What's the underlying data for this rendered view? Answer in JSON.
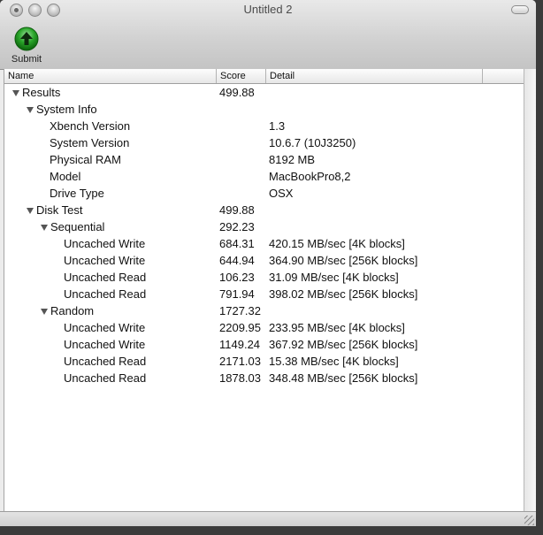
{
  "window": {
    "title": "Untitled 2"
  },
  "toolbar": {
    "submit_label": "Submit",
    "submit_icon": "up-arrow-circle-icon",
    "submit_color": "#1a9a1a"
  },
  "columns": [
    "Name",
    "Score",
    "Detail",
    ""
  ],
  "rows": [
    {
      "name": "Results",
      "score": "499.88",
      "detail": ""
    },
    {
      "name": "System Info",
      "score": "",
      "detail": ""
    },
    {
      "name": "Xbench Version",
      "score": "",
      "detail": "1.3"
    },
    {
      "name": "System Version",
      "score": "",
      "detail": "10.6.7 (10J3250)"
    },
    {
      "name": "Physical RAM",
      "score": "",
      "detail": "8192 MB"
    },
    {
      "name": "Model",
      "score": "",
      "detail": "MacBookPro8,2"
    },
    {
      "name": "Drive Type",
      "score": "",
      "detail": "OSX"
    },
    {
      "name": "Disk Test",
      "score": "499.88",
      "detail": ""
    },
    {
      "name": "Sequential",
      "score": "292.23",
      "detail": ""
    },
    {
      "name": "Uncached Write",
      "score": "684.31",
      "detail": "420.15 MB/sec [4K blocks]"
    },
    {
      "name": "Uncached Write",
      "score": "644.94",
      "detail": "364.90 MB/sec [256K blocks]"
    },
    {
      "name": "Uncached Read",
      "score": "106.23",
      "detail": "31.09 MB/sec [4K blocks]"
    },
    {
      "name": "Uncached Read",
      "score": "791.94",
      "detail": "398.02 MB/sec [256K blocks]"
    },
    {
      "name": "Random",
      "score": "1727.32",
      "detail": ""
    },
    {
      "name": "Uncached Write",
      "score": "2209.95",
      "detail": "233.95 MB/sec [4K blocks]"
    },
    {
      "name": "Uncached Write",
      "score": "1149.24",
      "detail": "367.92 MB/sec [256K blocks]"
    },
    {
      "name": "Uncached Read",
      "score": "2171.03",
      "detail": "15.38 MB/sec [4K blocks]"
    },
    {
      "name": "Uncached Read",
      "score": "1878.03",
      "detail": "348.48 MB/sec [256K blocks]"
    }
  ]
}
